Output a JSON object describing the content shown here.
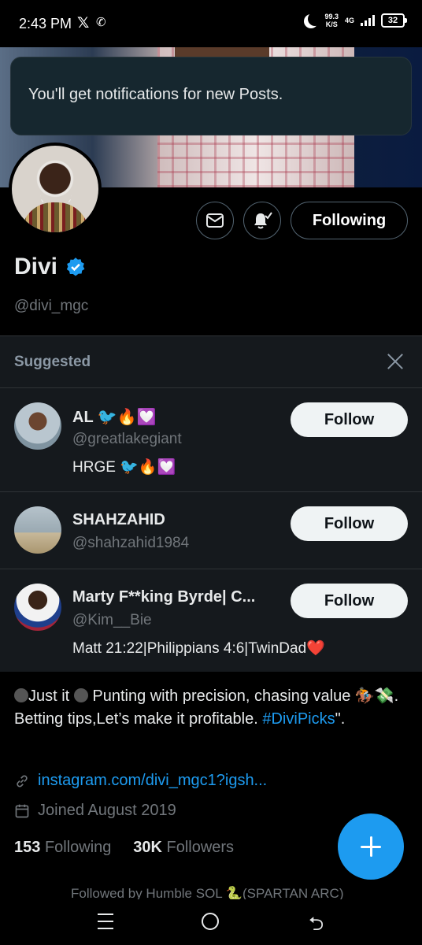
{
  "status_bar": {
    "time": "2:43 PM",
    "speed_value": "99.3",
    "speed_unit": "K/S",
    "network": "4G",
    "battery": "32"
  },
  "toast": {
    "text": "You'll get notifications for new Posts."
  },
  "profile": {
    "name": "Divi",
    "handle": "@divi_mgc",
    "following_button": "Following",
    "verified_color": "#1d9bf0"
  },
  "suggested": {
    "title": "Suggested",
    "items": [
      {
        "name": "AL 🐦🔥💟",
        "handle": "@greatlakegiant",
        "bio": "HRGE 🐦🔥💟",
        "button": "Follow"
      },
      {
        "name": "SHAHZAHID",
        "handle": "@shahzahid1984",
        "bio": "",
        "button": "Follow"
      },
      {
        "name": "Marty F**king Byrde| C...",
        "handle": "@Kim__Bie",
        "bio": "Matt 21:22|Philippians 4:6|TwinDad❤️",
        "button": "Follow"
      }
    ]
  },
  "bio": {
    "line_part1": "Just it ",
    "line_part2": " Punting with precision, chasing value 🏇💸. Betting tips,Let’s make it profitable. ",
    "hashtag": "#DiviPicks",
    "suffix": "\"."
  },
  "link": {
    "text": "instagram.com/divi_mgc1?igsh..."
  },
  "joined": {
    "text": "Joined August 2019"
  },
  "counts": {
    "following_count": "153",
    "following_label": "Following",
    "followers_count": "30K",
    "followers_label": "Followers"
  },
  "followed_by": {
    "text": "Followed by Humble SOL 🐍(SPARTAN ARC)"
  },
  "colors": {
    "accent": "#1d9bf0",
    "background": "#000000",
    "card": "#15191d"
  }
}
